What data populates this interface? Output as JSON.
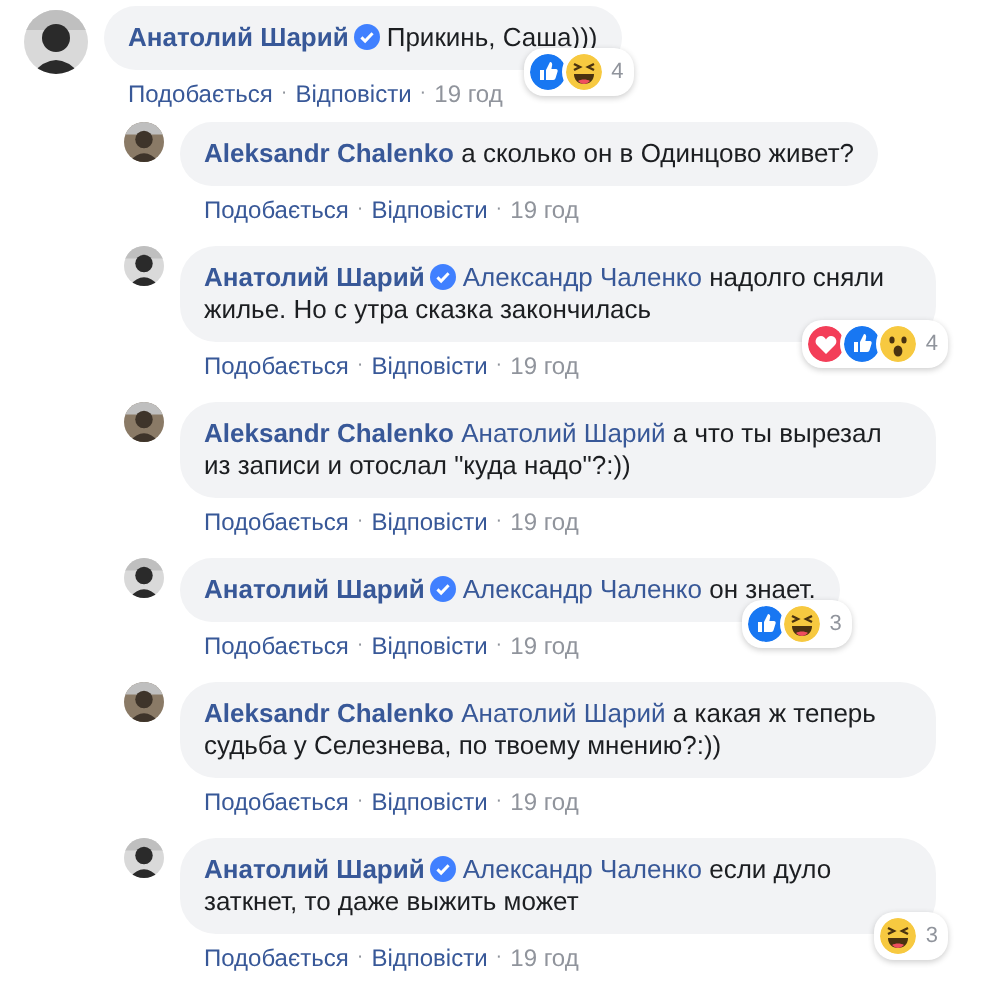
{
  "separator": "·",
  "comments": [
    {
      "author": "Анатолий Шарий",
      "verified": true,
      "text": "Прикинь, Саша)))",
      "reactions": [
        {
          "kind": "like"
        },
        {
          "kind": "haha"
        }
      ],
      "reaction_count": "4",
      "actions": [
        "Подобається",
        "Відповісти"
      ],
      "time": "19 год",
      "avatar": {
        "kind": "picture"
      },
      "replies": [
        {
          "author": "Aleksandr Chalenko",
          "verified": false,
          "text": "а сколько он в Одинцово живет?",
          "actions": [
            "Подобається",
            "Відповісти"
          ],
          "time": "19 год",
          "avatar": {
            "kind": "picture"
          }
        },
        {
          "author": "Анатолий Шарий",
          "verified": true,
          "mention": "Александр Чаленко",
          "text": "надолго сняли жилье. Но с утра сказка закончилась",
          "reactions": [
            {
              "kind": "love"
            },
            {
              "kind": "like"
            },
            {
              "kind": "wow"
            }
          ],
          "reaction_count": "4",
          "actions": [
            "Подобається",
            "Відповісти"
          ],
          "time": "19 год",
          "avatar": {
            "kind": "picture"
          }
        },
        {
          "author": "Aleksandr Chalenko",
          "verified": false,
          "mention": "Анатолий Шарий",
          "text": "а что ты вырезал из записи и отослал \"куда надо\"?:))",
          "actions": [
            "Подобається",
            "Відповісти"
          ],
          "time": "19 год",
          "avatar": {
            "kind": "picture"
          }
        },
        {
          "author": "Анатолий Шарий",
          "verified": true,
          "mention": "Александр Чаленко",
          "text": "он знает.",
          "reactions": [
            {
              "kind": "like"
            },
            {
              "kind": "haha"
            }
          ],
          "reaction_count": "3",
          "actions": [
            "Подобається",
            "Відповісти"
          ],
          "time": "19 год",
          "avatar": {
            "kind": "picture"
          }
        },
        {
          "author": "Aleksandr Chalenko",
          "verified": false,
          "mention": "Анатолий Шарий",
          "text": "а какая ж теперь судьба у Селезнева, по твоему мнению?:))",
          "actions": [
            "Подобається",
            "Відповісти"
          ],
          "time": "19 год",
          "avatar": {
            "kind": "picture"
          }
        },
        {
          "author": "Анатолий Шарий",
          "verified": true,
          "mention": "Александр Чаленко",
          "text": "если дуло заткнет, то даже выжить может",
          "reactions": [
            {
              "kind": "haha"
            }
          ],
          "reaction_count": "3",
          "actions": [
            "Подобається",
            "Відповісти"
          ],
          "time": "19 год",
          "avatar": {
            "kind": "picture"
          }
        }
      ]
    }
  ]
}
